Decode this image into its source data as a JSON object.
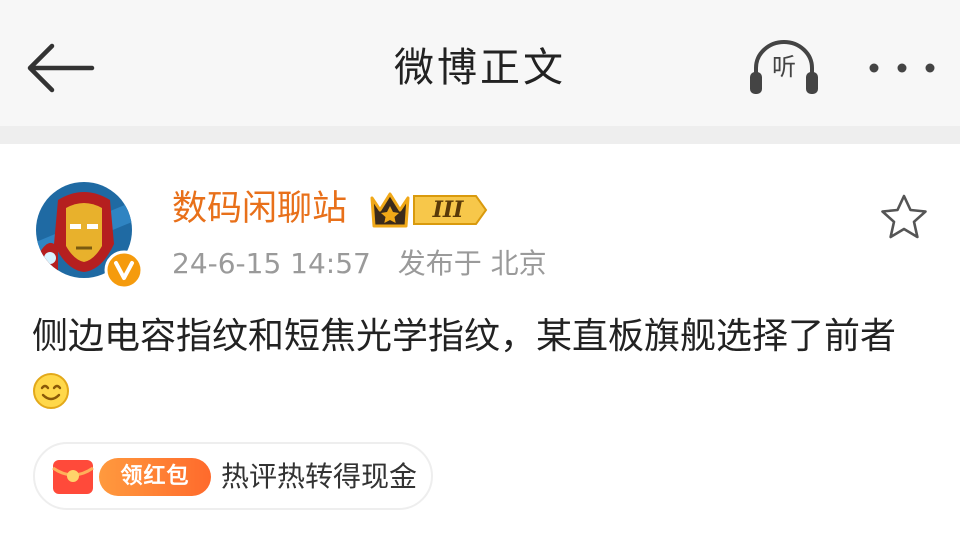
{
  "header": {
    "title": "微博正文",
    "listen_label": "听"
  },
  "post": {
    "author": {
      "name": "数码闲聊站",
      "level_badge": "III"
    },
    "meta": {
      "time": "24-6-15 14:57",
      "location": "发布于 北京"
    },
    "body_text": "侧边电容指纹和短焦光学指纹，某直板旗舰选择了前者",
    "body_emoji": "smile-emoji"
  },
  "promo": {
    "tag_label": "领红包",
    "text": "热评热转得现金"
  },
  "colors": {
    "topbar_bg": "#f7f7f7",
    "username": "#e8701a",
    "meta_text": "#9a9a9a",
    "body_text": "#222222",
    "promo_tag": "#ff6a2c"
  }
}
